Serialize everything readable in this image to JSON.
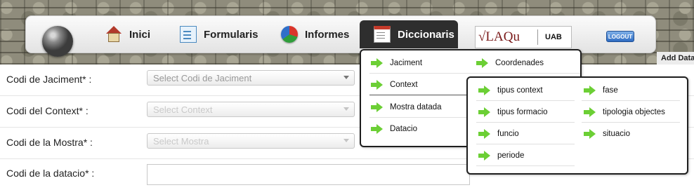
{
  "nav": {
    "items": [
      {
        "label": "Inici",
        "icon": "home-icon"
      },
      {
        "label": "Formularis",
        "icon": "form-icon"
      },
      {
        "label": "Informes",
        "icon": "pie-chart-icon"
      },
      {
        "label": "Diccionaris",
        "icon": "calendar-icon"
      }
    ],
    "active": "Diccionaris",
    "logout_label": "LOGOUT",
    "logo": {
      "left_text": "√LAQu",
      "right_text": "UAB"
    },
    "add_data_label": "Add Data"
  },
  "form": {
    "fields": [
      {
        "label": "Codi de Jaciment* :",
        "placeholder": "Select Codi de Jaciment",
        "enabled": true
      },
      {
        "label": "Codi del Context* :",
        "placeholder": "Select Context",
        "enabled": false
      },
      {
        "label": "Codi de la Mostra* :",
        "placeholder": "Select Mostra",
        "enabled": false
      },
      {
        "label": "Codi de la datacio* :"
      }
    ]
  },
  "menu": {
    "main_col1": [
      "Jaciment",
      "Context",
      "Mostra datada",
      "Datacio"
    ],
    "main_col2": [
      "Coordenades"
    ],
    "highlighted": "Context",
    "sub_col1": [
      "tipus context",
      "tipus formacio",
      "funcio",
      "periode"
    ],
    "sub_col2": [
      "fase",
      "tipologia objectes",
      "situacio"
    ]
  },
  "colors": {
    "accent_arrow": "#6ccf35",
    "active_tab": "#2e2e2e"
  }
}
